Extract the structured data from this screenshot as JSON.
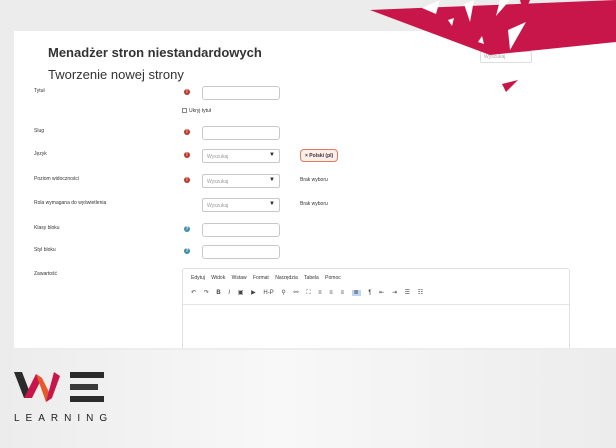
{
  "page": {
    "title": "Menadżer stron niestandardowych",
    "subtitle": "Tworzenie nowej strony",
    "search_ghost": "Wyszukaj"
  },
  "form": {
    "tytul": "Tytuł",
    "ukryj": "Ukryj tytuł",
    "slug": "Slug",
    "jezyk": "Język",
    "jezyk_placeholder": "Wyszukaj",
    "jezyk_chip": "× Polski (pl)",
    "poziom": "Poziom widoczności",
    "poziom_placeholder": "Wyszukaj",
    "poziom_note": "Brak wyboru",
    "rola": "Rola wymagana do wyświetlenia",
    "rola_placeholder": "Wyszukaj",
    "rola_note": "Brak wyboru",
    "klasy": "Klasy bloku",
    "styl": "Styl bloku",
    "zawartosc": "Zawartość"
  },
  "editor": {
    "menu": [
      "Edytuj",
      "Widok",
      "Wstaw",
      "Format",
      "Narzędzia",
      "Tabela",
      "Pomoc"
    ],
    "toolbar": [
      "↶",
      "↷",
      "B",
      "I",
      "▣",
      "▶",
      "H-P",
      "⚲",
      "⚯",
      "⛶",
      "≡",
      "≡",
      "≡",
      "≣",
      "¶",
      "⇤",
      "⇥",
      "☰",
      "☷"
    ]
  },
  "brand": {
    "wordmark": "LEARNING",
    "accent": "#c8164a"
  }
}
